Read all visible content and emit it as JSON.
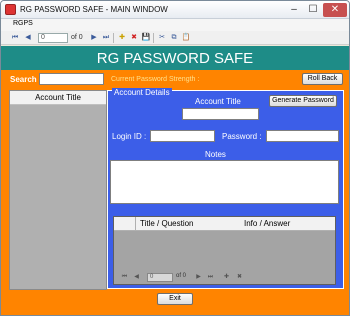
{
  "window": {
    "title": "RG PASSWORD SAFE - MAIN WINDOW",
    "minimize": "–",
    "maximize": "☐",
    "close": "✕"
  },
  "menu": {
    "items": [
      "RGPS"
    ]
  },
  "navigator": {
    "first": "⏮",
    "prev": "◀",
    "position": "0",
    "of": "of 0",
    "next": "▶",
    "last": "⏭",
    "add": "✚",
    "delete": "✖",
    "save": "💾",
    "cut": "✂",
    "copy": "⧉",
    "paste": "📋"
  },
  "banner": {
    "title": "RG PASSWORD SAFE"
  },
  "search": {
    "label": "Search",
    "value": ""
  },
  "strength": {
    "label": "Current Password Strength :"
  },
  "rollback": {
    "label": "Roll Back"
  },
  "account_list": {
    "header": "Account Title"
  },
  "details": {
    "legend": "Account Details",
    "account_title_label": "Account Title",
    "generate_label": "Generate Password",
    "login_label": "Login ID :",
    "password_label": "Password :",
    "notes_label": "Notes"
  },
  "qa_grid": {
    "col1": "Title / Question",
    "col2": "Info / Answer",
    "nav": {
      "position": "0",
      "of": "of 0"
    }
  },
  "exit": {
    "label": "Exit"
  },
  "colors": {
    "banner": "#1e8c87",
    "background": "#ff8400",
    "panel": "#3c5ee8"
  }
}
